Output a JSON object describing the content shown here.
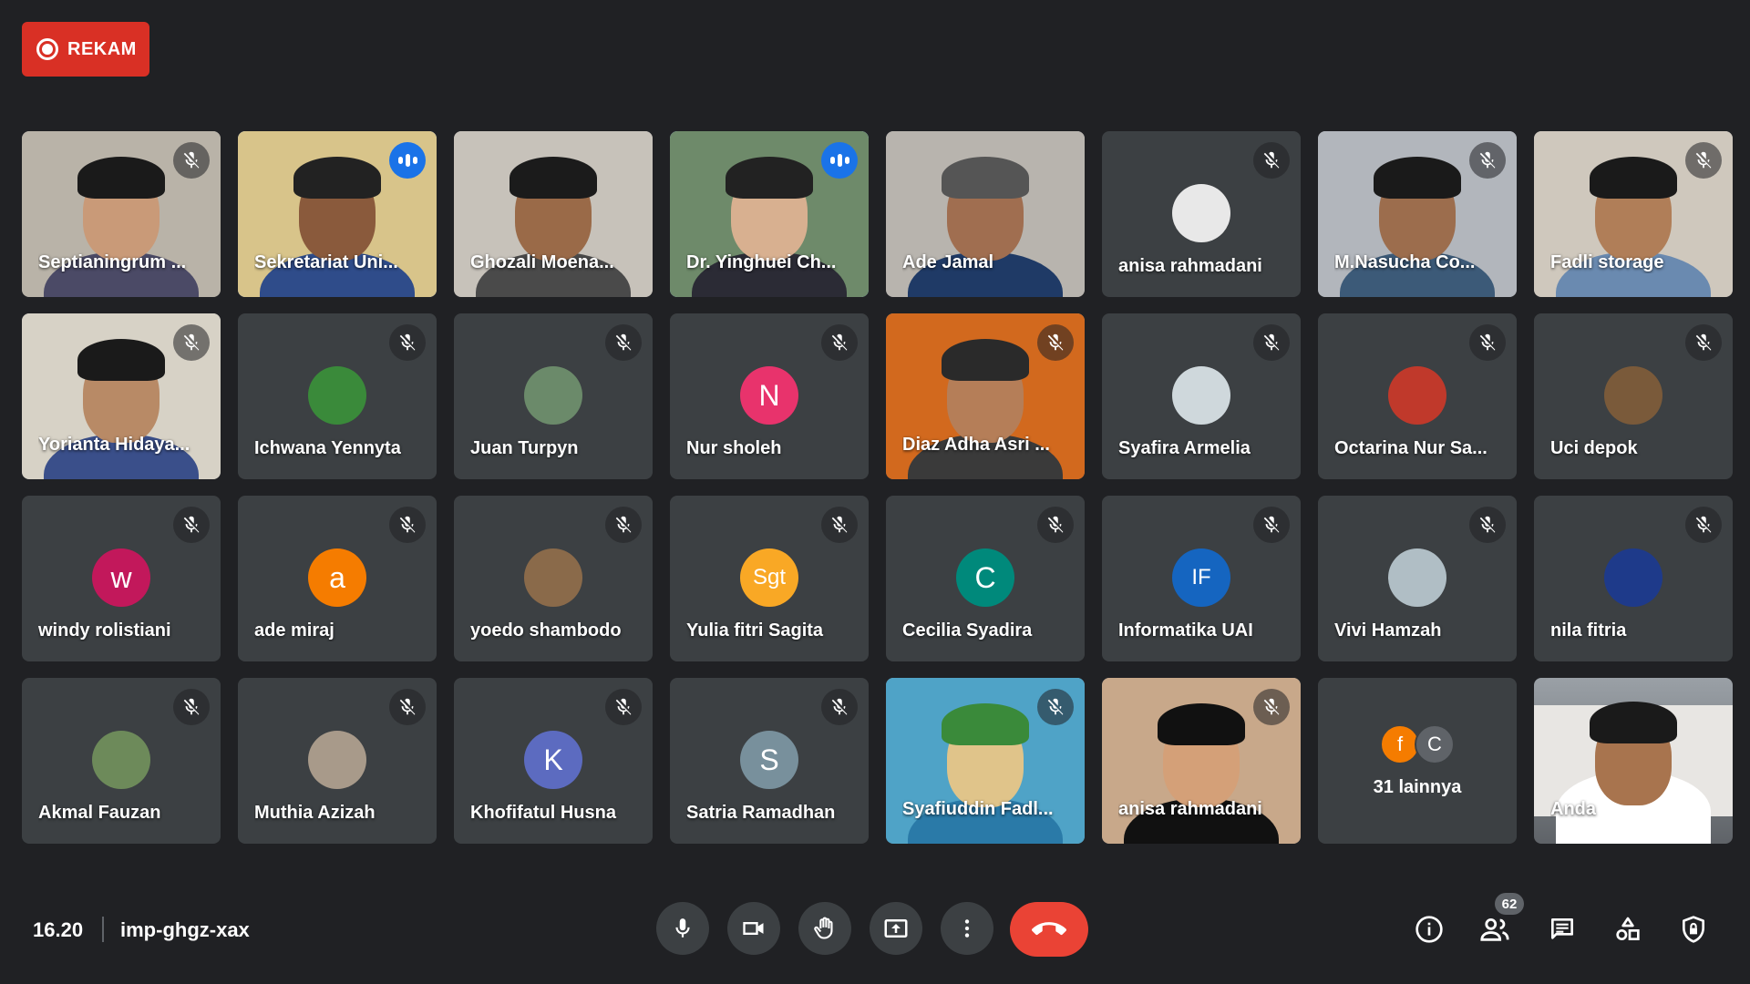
{
  "record": {
    "label": "REKAM"
  },
  "tiles": [
    {
      "name": "Septianingrum ...",
      "type": "video",
      "muted": true,
      "bg": "#b9b3a8",
      "face": "#c99a78",
      "hair": "#1a1a1a",
      "body": "#4b4a66"
    },
    {
      "name": "Sekretariat Uni...",
      "type": "video",
      "speaking": true,
      "bg": "#d8c48a",
      "face": "#8a5a3c",
      "hair": "#222",
      "body": "#2f4c8a"
    },
    {
      "name": "Ghozali Moena...",
      "type": "video",
      "muted": false,
      "bg": "#c7c2ba",
      "face": "#9a6a48",
      "hair": "#1b1b1b",
      "body": "#4a4a4a"
    },
    {
      "name": "Dr. Yinghuei Ch...",
      "type": "video",
      "speaking": true,
      "bg": "#6e8a6a",
      "face": "#d8b090",
      "hair": "#222",
      "body": "#2b2b35"
    },
    {
      "name": "Ade Jamal",
      "type": "video",
      "muted": false,
      "bg": "#b8b4ae",
      "face": "#a06e50",
      "hair": "#555",
      "body": "#1f3a66"
    },
    {
      "name": "anisa rahmadani",
      "type": "avatar",
      "muted": true,
      "color": "#e8e8e8",
      "letter": ""
    },
    {
      "name": "M.Nasucha Co...",
      "type": "video",
      "muted": true,
      "bg": "#b2b6bc",
      "face": "#9c6d4d",
      "hair": "#1a1a1a",
      "body": "#3c5a78"
    },
    {
      "name": "Fadli storage",
      "type": "video",
      "muted": true,
      "bg": "#cfc8bd",
      "face": "#b07e58",
      "hair": "#1a1a1a",
      "body": "#6a8ab0"
    },
    {
      "name": "Yorianta Hidaya...",
      "type": "video",
      "muted": true,
      "bg": "#d7d2c6",
      "face": "#b88a66",
      "hair": "#1a1a1a",
      "body": "#3a4f8a"
    },
    {
      "name": "Ichwana Yennyta",
      "type": "avatar",
      "muted": true,
      "color": "#3a8a3a",
      "letter": ""
    },
    {
      "name": "Juan Turpyn",
      "type": "avatar",
      "muted": true,
      "color": "#6b8a6a",
      "letter": ""
    },
    {
      "name": "Nur sholeh",
      "type": "avatar",
      "muted": true,
      "color": "#e8336c",
      "letter": "N"
    },
    {
      "name": "Diaz Adha Asri ...",
      "type": "video",
      "muted": true,
      "bg": "#d2691e",
      "face": "#b57e58",
      "hair": "#2a2a2a",
      "body": "#3a3a3a"
    },
    {
      "name": "Syafira Armelia",
      "type": "avatar",
      "muted": true,
      "color": "#cfd8dc",
      "letter": ""
    },
    {
      "name": "Octarina Nur Sa...",
      "type": "avatar",
      "muted": true,
      "color": "#c0392b",
      "letter": ""
    },
    {
      "name": "Uci depok",
      "type": "avatar",
      "muted": true,
      "color": "#7a5a3a",
      "letter": ""
    },
    {
      "name": "windy rolistiani",
      "type": "avatar",
      "muted": true,
      "color": "#c2185b",
      "letter": "w"
    },
    {
      "name": "ade miraj",
      "type": "avatar",
      "muted": true,
      "color": "#f57c00",
      "letter": "a"
    },
    {
      "name": "yoedo shambodo",
      "type": "avatar",
      "muted": true,
      "color": "#8a6a4a",
      "letter": ""
    },
    {
      "name": "Yulia fitri Sagita",
      "type": "avatar",
      "muted": true,
      "color": "#f9a825",
      "letter": "Sgt"
    },
    {
      "name": "Cecilia Syadira",
      "type": "avatar",
      "muted": true,
      "color": "#00897b",
      "letter": "C"
    },
    {
      "name": "Informatika UAI",
      "type": "avatar",
      "muted": true,
      "color": "#1565c0",
      "letter": "IF"
    },
    {
      "name": "Vivi Hamzah",
      "type": "avatar",
      "muted": true,
      "color": "#b0bec5",
      "letter": ""
    },
    {
      "name": "nila fitria",
      "type": "avatar",
      "muted": true,
      "color": "#1e3a8a",
      "letter": ""
    },
    {
      "name": "Akmal Fauzan",
      "type": "avatar",
      "muted": true,
      "color": "#6d8a5a",
      "letter": ""
    },
    {
      "name": "Muthia Azizah",
      "type": "avatar",
      "muted": true,
      "color": "#a89a8a",
      "letter": ""
    },
    {
      "name": "Khofifatul Husna",
      "type": "avatar",
      "muted": true,
      "color": "#5c6bc0",
      "letter": "K"
    },
    {
      "name": "Satria Ramadhan",
      "type": "avatar",
      "muted": true,
      "color": "#78909c",
      "letter": "S"
    },
    {
      "name": "Syafiuddin Fadl...",
      "type": "video",
      "muted": true,
      "bg": "#4fa3c7",
      "face": "#e0c48a",
      "hair": "#3a8a3a",
      "body": "#2a7aa8"
    },
    {
      "name": "anisa rahmadani",
      "type": "video",
      "muted": true,
      "bg": "#c8a88a",
      "face": "#d4a078",
      "hair": "#111",
      "body": "#111"
    },
    {
      "name": "31 lainnya",
      "type": "others",
      "avatars": [
        {
          "letter": "f",
          "color": "#f57c00"
        },
        {
          "letter": "C",
          "color": "#5f6368"
        }
      ]
    },
    {
      "name": "Anda",
      "type": "video",
      "muted": false,
      "self": true,
      "bg": "#e8e6e3",
      "face": "#a8744e",
      "hair": "#1a1a1a",
      "body": "#ffffff"
    }
  ],
  "bottom": {
    "time": "16.20",
    "meeting_code": "imp-ghgz-xax",
    "participant_count": "62"
  },
  "icons": {
    "mic": "mic-icon",
    "camera": "videocam-icon",
    "hand": "raise-hand-icon",
    "present": "present-screen-icon",
    "more": "more-vert-icon",
    "hangup": "call-end-icon",
    "info": "info-icon",
    "people": "people-icon",
    "chat": "chat-icon",
    "activities": "activities-icon",
    "host": "host-controls-icon"
  }
}
